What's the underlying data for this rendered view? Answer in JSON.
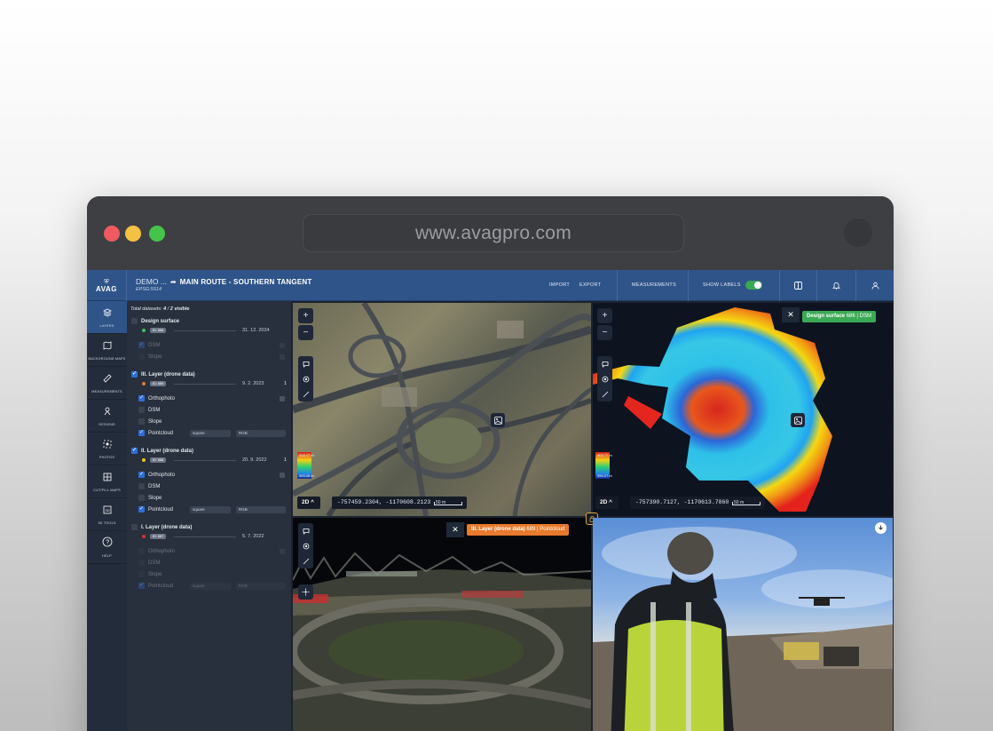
{
  "browser": {
    "url": "www.avagpro.com"
  },
  "header": {
    "logo_text": "AVAG",
    "project": "DEMO ...",
    "route": "MAIN ROUTE - SOUTHERN TANGENT",
    "epsg": "EPSG:5514",
    "nav": {
      "import": "IMPORT",
      "export": "EXPORT",
      "measurements": "MEASUREMENTS",
      "show_labels": "SHOW LABELS"
    },
    "show_labels_on": true
  },
  "rail": [
    {
      "label": "LAYERS",
      "icon": "layers-icon",
      "active": true
    },
    {
      "label": "BACKGROUND MAPS",
      "icon": "map-icon",
      "active": false
    },
    {
      "label": "MEASUREMENTS",
      "icon": "ruler-icon",
      "active": false
    },
    {
      "label": "DESIGNS",
      "icon": "design-icon",
      "active": false
    },
    {
      "label": "PHOTOS",
      "icon": "camera-icon",
      "active": false
    },
    {
      "label": "CUT/FILL MAPS",
      "icon": "grid-icon",
      "active": false
    },
    {
      "label": "3D TOOLS",
      "icon": "cube-icon",
      "active": false
    },
    {
      "label": "HELP",
      "icon": "help-icon",
      "active": false
    }
  ],
  "panel": {
    "total_label": "Total datasets:",
    "total_count": "4",
    "visible_label": "2 visible",
    "datasets": [
      {
        "name": "Design surface",
        "checked": false,
        "status_color": "#3ac45a",
        "id": "ID: 686",
        "date": "31. 12. 2024",
        "count": "",
        "children": [
          {
            "label": "DSM",
            "checked": true,
            "dim": true
          },
          {
            "label": "Slope",
            "checked": false,
            "dim": true
          }
        ]
      },
      {
        "name": "III. Layer (drone data)",
        "checked": true,
        "status_color": "#e77a2c",
        "id": "ID: 689",
        "date": "9. 2. 2023",
        "count": "1",
        "children": [
          {
            "label": "Orthophoto",
            "checked": true,
            "dim": false
          },
          {
            "label": "DSM",
            "checked": false,
            "dim": false
          },
          {
            "label": "Slope",
            "checked": false,
            "dim": false
          },
          {
            "label": "Pointcloud",
            "checked": true,
            "dim": false,
            "sel1": "square",
            "sel2": "RGB"
          }
        ]
      },
      {
        "name": "II. Layer (drone data)",
        "checked": true,
        "status_color": "#f0c419",
        "id": "ID: 688",
        "date": "20. 9. 2022",
        "count": "1",
        "children": [
          {
            "label": "Orthophoto",
            "checked": true,
            "dim": false
          },
          {
            "label": "DSM",
            "checked": false,
            "dim": false
          },
          {
            "label": "Slope",
            "checked": false,
            "dim": false
          },
          {
            "label": "Pointcloud",
            "checked": true,
            "dim": false,
            "sel1": "square",
            "sel2": "RGB"
          }
        ]
      },
      {
        "name": "I. Layer (drone data)",
        "checked": false,
        "status_color": "#d9302f",
        "id": "ID: 687",
        "date": "5. 7. 2022",
        "count": "",
        "children": [
          {
            "label": "Orthophoto",
            "checked": false,
            "dim": true
          },
          {
            "label": "DSM",
            "checked": false,
            "dim": true
          },
          {
            "label": "Slope",
            "checked": false,
            "dim": true
          },
          {
            "label": "Pointcloud",
            "checked": true,
            "dim": true,
            "sel1": "square",
            "sel2": "RGB"
          }
        ]
      }
    ]
  },
  "viewports": {
    "ortho": {
      "mode": "2D",
      "coords": "-757459.2304, -1170608.2123",
      "scale": "50 m",
      "scale_max": "418.47 m",
      "scale_min": "393.28 m"
    },
    "dsm": {
      "label_name": "Design surface",
      "label_id": "686 | DSM",
      "label_color": "#3aa955",
      "mode": "2D",
      "coords": "-757390.7127, -1170613.7860",
      "scale": "50 m",
      "scale_max": "403.77 m",
      "scale_min": "394.27 m"
    },
    "pointcloud": {
      "label_name": "III. Layer (drone data)",
      "label_id": "689 | Pointcloud",
      "label_color": "#e77a2c"
    },
    "photo": {}
  }
}
